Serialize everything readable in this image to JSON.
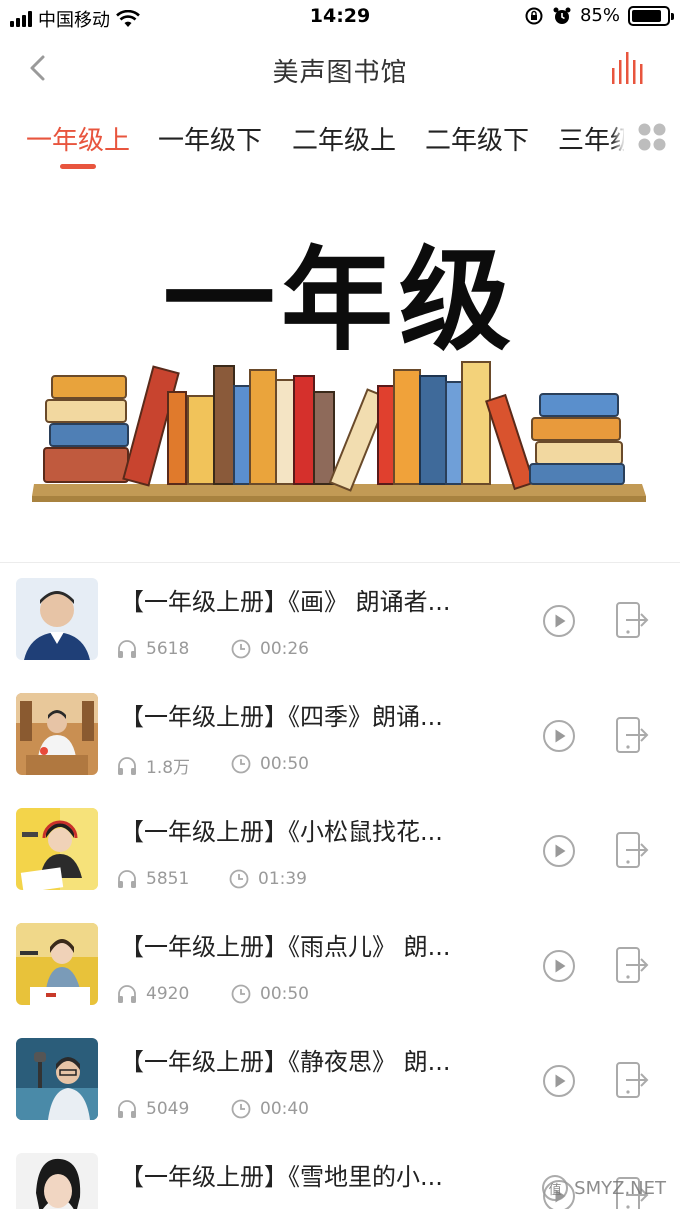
{
  "status_bar": {
    "carrier": "中国移动",
    "time": "14:29",
    "battery_pct": "85%",
    "battery_level": 0.85,
    "icons": [
      "signal-icon",
      "wifi-icon",
      "rotation-lock-icon",
      "alarm-icon",
      "battery-icon"
    ]
  },
  "nav": {
    "title": "美声图书馆",
    "back_icon": "chevron-left-icon",
    "right_icon": "audio-bars-icon"
  },
  "tabs": [
    {
      "label": "一年级上",
      "active": true
    },
    {
      "label": "一年级下",
      "active": false
    },
    {
      "label": "二年级上",
      "active": false
    },
    {
      "label": "二年级下",
      "active": false
    },
    {
      "label": "三年级",
      "active": false
    }
  ],
  "banner": {
    "title": "一年级"
  },
  "items": [
    {
      "title": "【一年级上册】《画》 朗诵者...",
      "plays": "5618",
      "duration": "00:26"
    },
    {
      "title": "【一年级上册】《四季》朗诵...",
      "plays": "1.8万",
      "duration": "00:50"
    },
    {
      "title": "【一年级上册】《小松鼠找花...",
      "plays": "5851",
      "duration": "01:39"
    },
    {
      "title": "【一年级上册】《雨点儿》 朗...",
      "plays": "4920",
      "duration": "00:50"
    },
    {
      "title": "【一年级上册】《静夜思》 朗...",
      "plays": "5049",
      "duration": "00:40"
    },
    {
      "title": "【一年级上册】《雪地里的小...",
      "plays": "",
      "duration": ""
    }
  ],
  "colors": {
    "accent": "#e8553e",
    "meta": "#9a9a9a"
  },
  "watermark": {
    "badge": "值",
    "text": "SMYZ.NET"
  }
}
